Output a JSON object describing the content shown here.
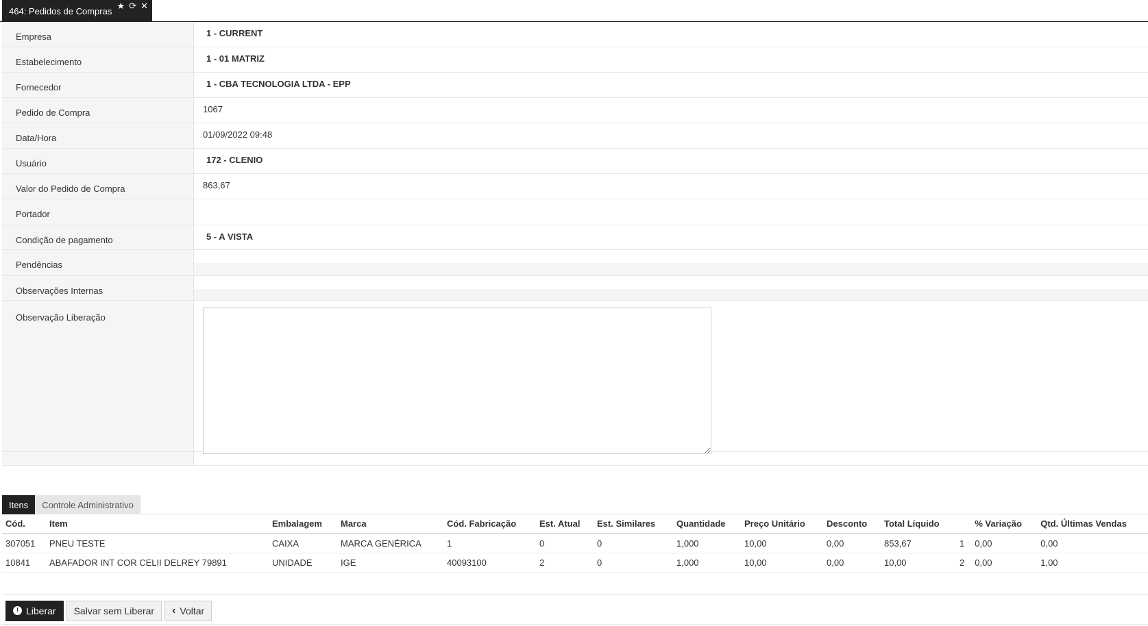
{
  "window": {
    "title": "464: Pedidos de Compras",
    "icons": {
      "favorite": "★",
      "refresh": "⟳",
      "close": "✕"
    }
  },
  "form": {
    "empresa": {
      "label": "Empresa",
      "value": "1 - CURRENT"
    },
    "estabelecimento": {
      "label": "Estabelecimento",
      "value": "1 - 01 MATRIZ"
    },
    "fornecedor": {
      "label": "Fornecedor",
      "value": "1 - CBA TECNOLOGIA LTDA - EPP"
    },
    "pedido": {
      "label": "Pedido de Compra",
      "value": "1067"
    },
    "datahora": {
      "label": "Data/Hora",
      "value": "01/09/2022 09:48"
    },
    "usuario": {
      "label": "Usuário",
      "value": "172 - CLENIO"
    },
    "valor": {
      "label": "Valor do Pedido de Compra",
      "value": "863,67"
    },
    "portador": {
      "label": "Portador",
      "value": ""
    },
    "condicao": {
      "label": "Condição de pagamento",
      "value": "5 - A VISTA"
    },
    "pendencias": {
      "label": "Pendências",
      "value": ""
    },
    "obs_internas": {
      "label": "Observações Internas",
      "value": ""
    },
    "obs_liberacao": {
      "label": "Observação Liberação",
      "value": ""
    }
  },
  "tabs": [
    {
      "label": "Itens",
      "active": true
    },
    {
      "label": "Controle Administrativo",
      "active": false
    }
  ],
  "table": {
    "headers": [
      "Cód.",
      "Item",
      "Embalagem",
      "Marca",
      "Cód. Fabricação",
      "Est. Atual",
      "Est. Similares",
      "Quantidade",
      "Preço Unitário",
      "Desconto",
      "Total Líquido",
      "",
      "% Variação",
      "Qtd. Últimas Vendas"
    ],
    "rows": [
      [
        "307051",
        "PNEU TESTE",
        "CAIXA",
        "MARCA GENÉRICA",
        "1",
        "0",
        "0",
        "1,000",
        "10,00",
        "0,00",
        "853,67",
        "1",
        "0,00",
        "0,00"
      ],
      [
        "10841",
        "ABAFADOR INT COR CELII DELREY 79891",
        "UNIDADE",
        "IGE",
        "40093100",
        "2",
        "0",
        "1,000",
        "10,00",
        "0,00",
        "10,00",
        "2",
        "0,00",
        "1,00"
      ]
    ]
  },
  "footer": {
    "liberar": "Liberar",
    "salvar": "Salvar sem Liberar",
    "voltar": "Voltar",
    "voltar_icon": "‹"
  }
}
